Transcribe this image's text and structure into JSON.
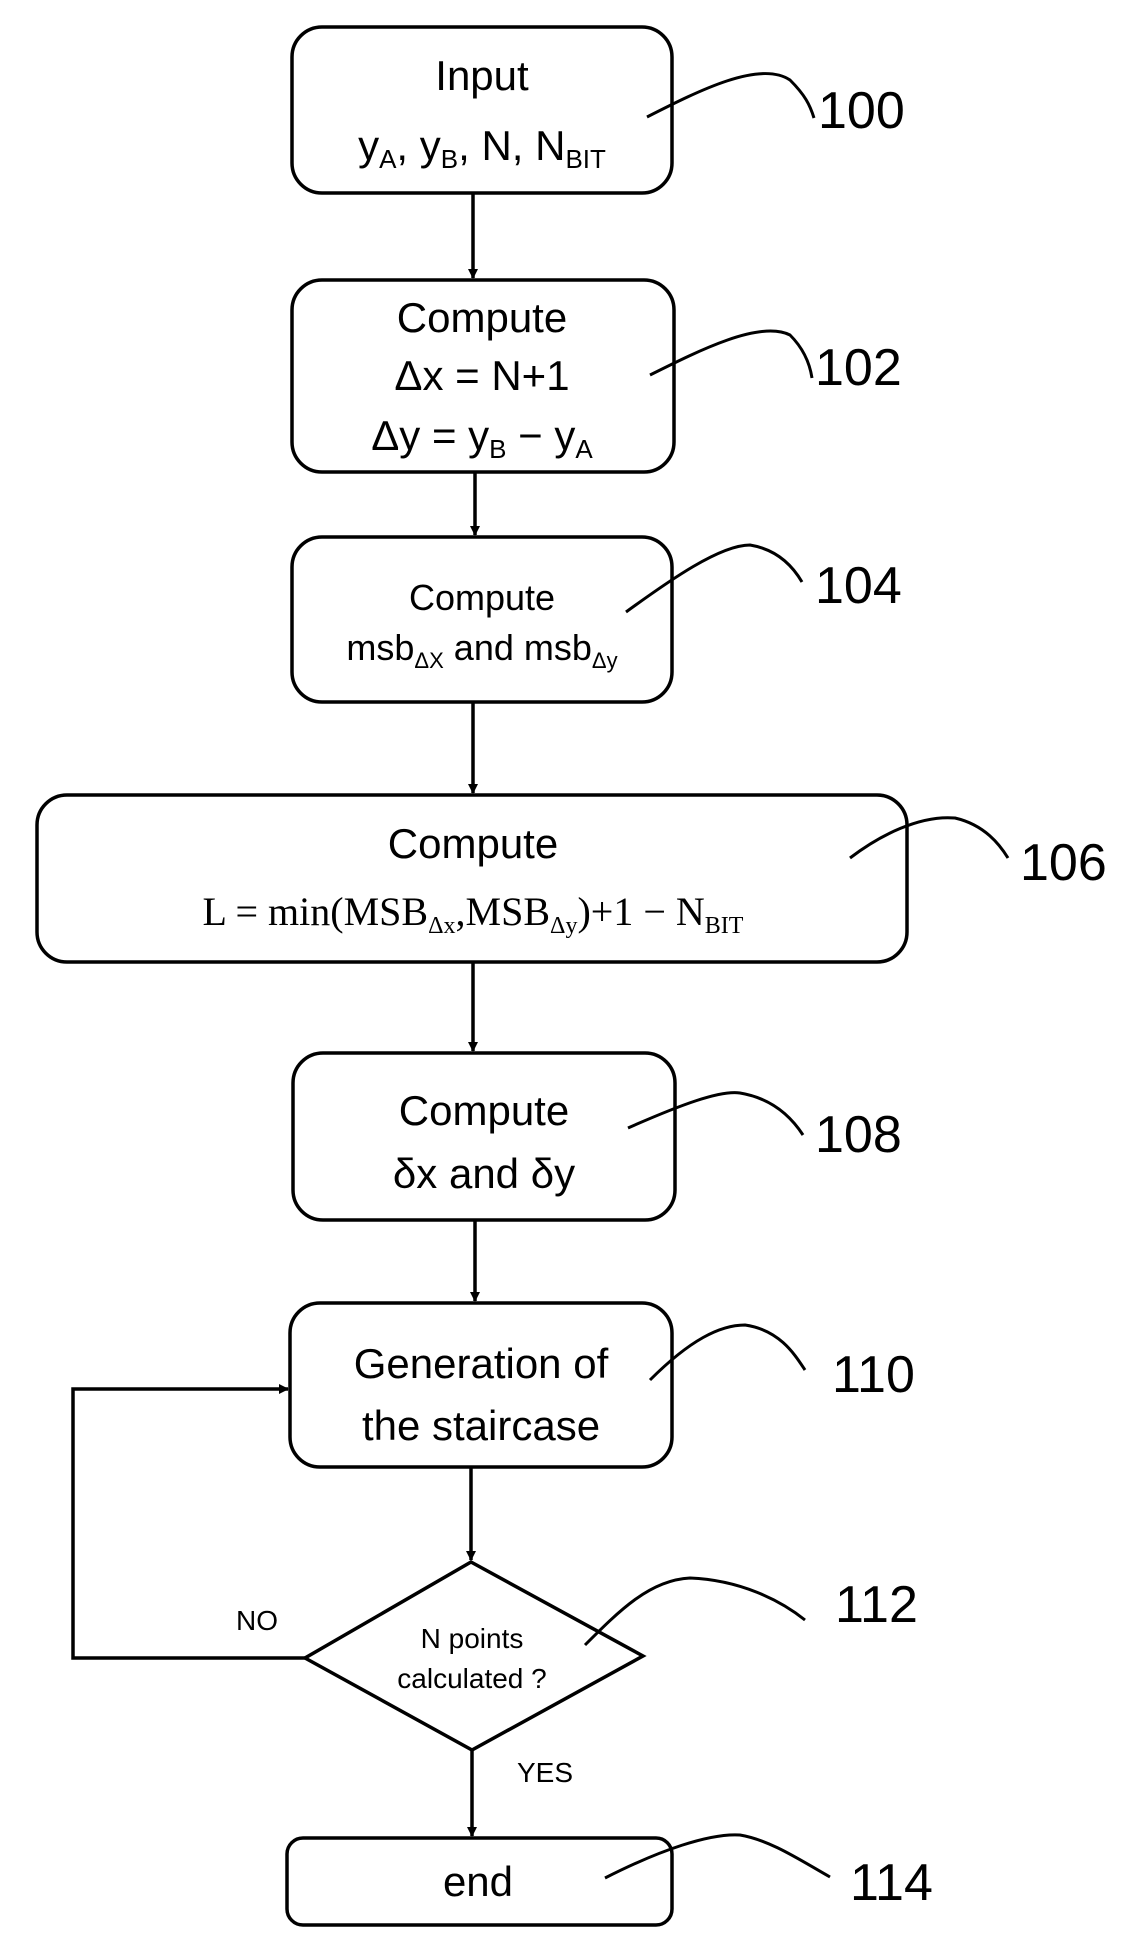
{
  "diagram": {
    "type": "flowchart",
    "nodes": [
      {
        "id": "100",
        "shape": "rounded-rect",
        "lines": [
          "Input",
          "y_A, y_B, N, N_BIT"
        ]
      },
      {
        "id": "102",
        "shape": "rounded-rect",
        "lines": [
          "Compute",
          "Δx = N+1",
          "Δy = y_B − y_A"
        ]
      },
      {
        "id": "104",
        "shape": "rounded-rect",
        "lines": [
          "Compute",
          "msb_Δx and msb_Δy"
        ]
      },
      {
        "id": "106",
        "shape": "rounded-rect",
        "lines": [
          "Compute",
          "L = min(MSB_Δx, MSB_Δy) + 1 − N_BIT"
        ]
      },
      {
        "id": "108",
        "shape": "rounded-rect",
        "lines": [
          "Compute",
          "δx and δy"
        ]
      },
      {
        "id": "110",
        "shape": "rounded-rect",
        "lines": [
          "Generation of",
          "the staircase"
        ]
      },
      {
        "id": "112",
        "shape": "diamond",
        "lines": [
          "N points",
          "calculated ?"
        ]
      },
      {
        "id": "114",
        "shape": "rounded-rect",
        "lines": [
          "end"
        ]
      }
    ],
    "edges": [
      {
        "from": "100",
        "to": "102",
        "label": ""
      },
      {
        "from": "102",
        "to": "104",
        "label": ""
      },
      {
        "from": "104",
        "to": "106",
        "label": ""
      },
      {
        "from": "106",
        "to": "108",
        "label": ""
      },
      {
        "from": "108",
        "to": "110",
        "label": ""
      },
      {
        "from": "110",
        "to": "112",
        "label": ""
      },
      {
        "from": "112",
        "to": "110",
        "label": "NO"
      },
      {
        "from": "112",
        "to": "114",
        "label": "YES"
      }
    ]
  },
  "text": {
    "n100": {
      "l1": "Input",
      "y": "y",
      "A": "A",
      "sep1": ", ",
      "B": "B",
      "sep2": ", N, N",
      "BIT": "BIT"
    },
    "n102": {
      "l1": "Compute",
      "l2": "Δx = N+1",
      "l3a": "Δy = y",
      "l3b": "B",
      "l3c": " − y",
      "l3d": "A"
    },
    "n104": {
      "l1": "Compute",
      "l2a": "msb",
      "l2b": "ΔX",
      "l2c": " and msb",
      "l2d": "Δy"
    },
    "n106": {
      "l1": "Compute",
      "l2a": "L = min(MSB",
      "l2b": "Δx",
      "l2c": ",MSB",
      "l2d": "Δy",
      "l2e": ")+1 − N",
      "l2f": "BIT"
    },
    "n108": {
      "l1": "Compute",
      "l2": "δx and δy"
    },
    "n110": {
      "l1": "Generation of",
      "l2": "the staircase"
    },
    "n112": {
      "l1": "N points",
      "l2": "calculated ?"
    },
    "n114": {
      "l1": "end"
    },
    "no_label": "NO",
    "yes_label": "YES"
  },
  "refs": {
    "r100": "100",
    "r102": "102",
    "r104": "104",
    "r106": "106",
    "r108": "108",
    "r110": "110",
    "r112": "112",
    "r114": "114"
  }
}
